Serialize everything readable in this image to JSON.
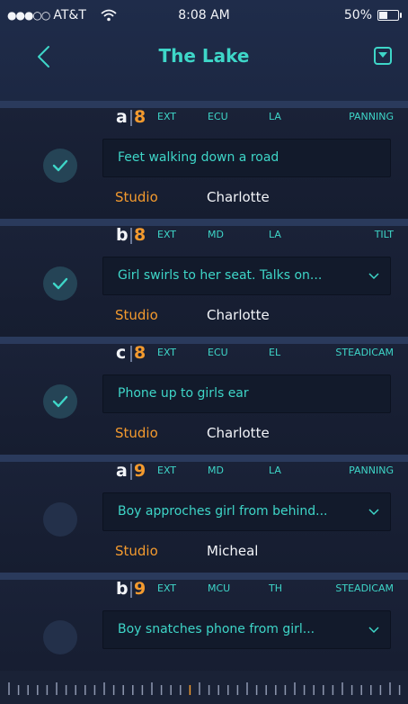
{
  "status_bar": {
    "signal_dots": "●●●○○",
    "carrier": "AT&T",
    "time": "8:08 AM",
    "battery": "50%",
    "battery_level": 0.5,
    "wifi_icon": "wifi-icon",
    "battery_icon": "battery-icon"
  },
  "nav": {
    "title": "The Lake",
    "back_icon": "chevron-left-icon",
    "menu_icon": "dropdown-box-icon"
  },
  "colors": {
    "accent": "#3ed6c8",
    "orange": "#f39a2e",
    "background": "#172036"
  },
  "shots": [
    {
      "letter": "a",
      "scene": "8",
      "tags": [
        "EXT",
        "ECU",
        "LA",
        "PANNING"
      ],
      "description": "Feet walking down a road",
      "has_dropdown": false,
      "location": "Studio",
      "person": "Charlotte",
      "checked": true
    },
    {
      "letter": "b",
      "scene": "8",
      "tags": [
        "EXT",
        "MD",
        "LA",
        "TILT"
      ],
      "description": "Girl swirls to her seat. Talks on...",
      "has_dropdown": true,
      "location": "Studio",
      "person": "Charlotte",
      "checked": true
    },
    {
      "letter": "c",
      "scene": "8",
      "tags": [
        "EXT",
        "ECU",
        "EL",
        "STEADICAM"
      ],
      "description": "Phone up to girls ear",
      "has_dropdown": false,
      "location": "Studio",
      "person": "Charlotte",
      "checked": true
    },
    {
      "letter": "a",
      "scene": "9",
      "tags": [
        "EXT",
        "MD",
        "LA",
        "PANNING"
      ],
      "description": "Boy approches girl from behind...",
      "has_dropdown": true,
      "location": "Studio",
      "person": "Micheal",
      "checked": false
    },
    {
      "letter": "b",
      "scene": "9",
      "tags": [
        "EXT",
        "MCU",
        "TH",
        "STEADICAM"
      ],
      "description": "Boy snatches phone from girl...",
      "has_dropdown": true,
      "location": "",
      "person": "",
      "checked": false
    }
  ],
  "ruler": {
    "ticks": 42,
    "highlight_index": 19
  }
}
